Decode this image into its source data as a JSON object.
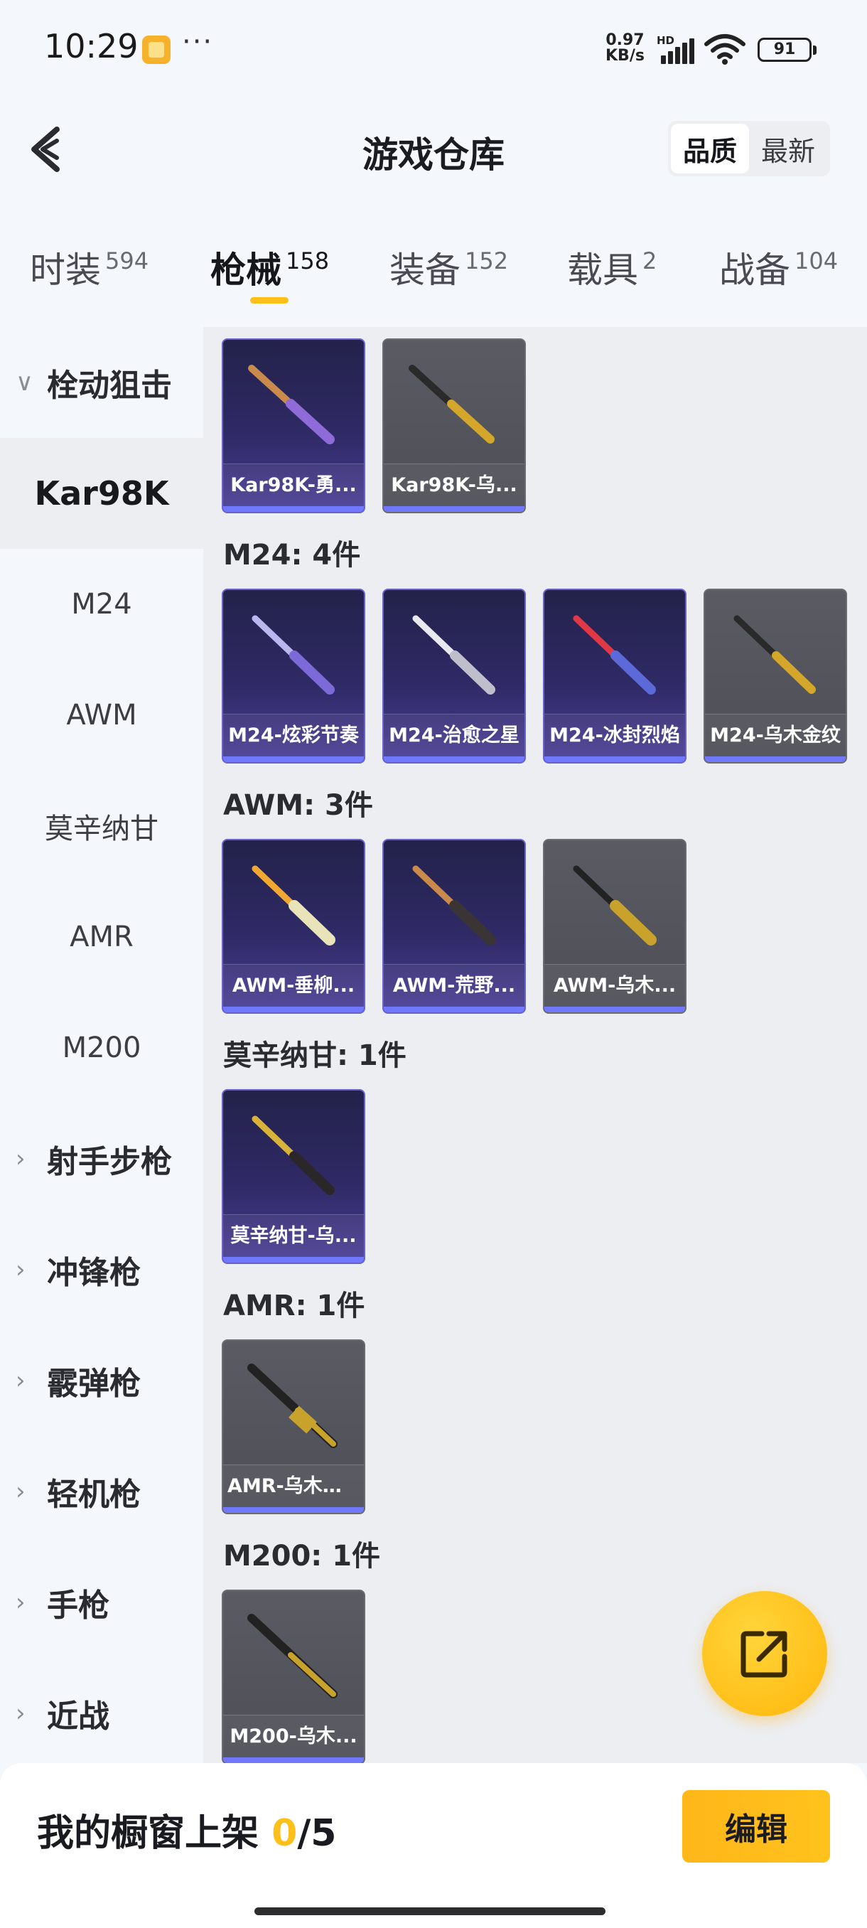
{
  "status_bar": {
    "time": "10:29",
    "more_indicator": "···",
    "net_speed_value": "0.97",
    "net_speed_unit": "KB/s",
    "network_label": "HD",
    "battery": "91"
  },
  "header": {
    "title": "游戏仓库",
    "sort_options": [
      "品质",
      "最新"
    ],
    "active_sort": "品质"
  },
  "tabs": [
    {
      "label": "时装",
      "count": "594"
    },
    {
      "label": "枪械",
      "count": "158",
      "active": true
    },
    {
      "label": "装备",
      "count": "152"
    },
    {
      "label": "载具",
      "count": "2"
    },
    {
      "label": "战备",
      "count": "104"
    }
  ],
  "sidebar": {
    "groups": [
      {
        "label": "栓动狙击",
        "expanded": true
      },
      {
        "label": "射手步枪"
      },
      {
        "label": "冲锋枪"
      },
      {
        "label": "霰弹枪"
      },
      {
        "label": "轻机枪"
      },
      {
        "label": "手枪"
      },
      {
        "label": "近战"
      }
    ],
    "sub_items": [
      "Kar98K",
      "M24",
      "AWM",
      "莫辛纳甘",
      "AMR",
      "M200"
    ],
    "selected": "Kar98K"
  },
  "content": {
    "sections": [
      {
        "title": "",
        "items": [
          {
            "name": "Kar98K-勇...",
            "rarity": "purple"
          },
          {
            "name": "Kar98K-乌...",
            "rarity": "gray"
          }
        ]
      },
      {
        "title": "M24: 4件",
        "items": [
          {
            "name": "M24-炫彩节奏",
            "rarity": "purple"
          },
          {
            "name": "M24-治愈之星",
            "rarity": "purple"
          },
          {
            "name": "M24-冰封烈焰",
            "rarity": "purple"
          },
          {
            "name": "M24-乌木金纹",
            "rarity": "gray"
          }
        ]
      },
      {
        "title": "AWM: 3件",
        "items": [
          {
            "name": "AWM-垂柳...",
            "rarity": "purple"
          },
          {
            "name": "AWM-荒野...",
            "rarity": "purple"
          },
          {
            "name": "AWM-乌木...",
            "rarity": "gray"
          }
        ]
      },
      {
        "title": "莫辛纳甘: 1件",
        "items": [
          {
            "name": "莫辛纳甘-乌...",
            "rarity": "purple"
          }
        ]
      },
      {
        "title": "AMR: 1件",
        "items": [
          {
            "name": "AMR-乌木金纹",
            "rarity": "gray"
          }
        ]
      },
      {
        "title": "M200: 1件",
        "items": [
          {
            "name": "M200-乌木...",
            "rarity": "gray"
          }
        ]
      }
    ]
  },
  "bottom_bar": {
    "showcase_label": "我的橱窗上架",
    "showcase_current": "0",
    "showcase_total": "/5",
    "edit_label": "编辑"
  },
  "colors": {
    "accent": "#ffbf1a",
    "rarity_purple": "#6a62c8",
    "rarity_gray": "#5a5b63",
    "rarity_bar": "#6f78ff"
  },
  "icons": {
    "back": "chevron-left-icon",
    "fab": "share-external-icon",
    "group_collapsed": "chevron-right-icon",
    "group_expanded": "chevron-down-icon"
  }
}
